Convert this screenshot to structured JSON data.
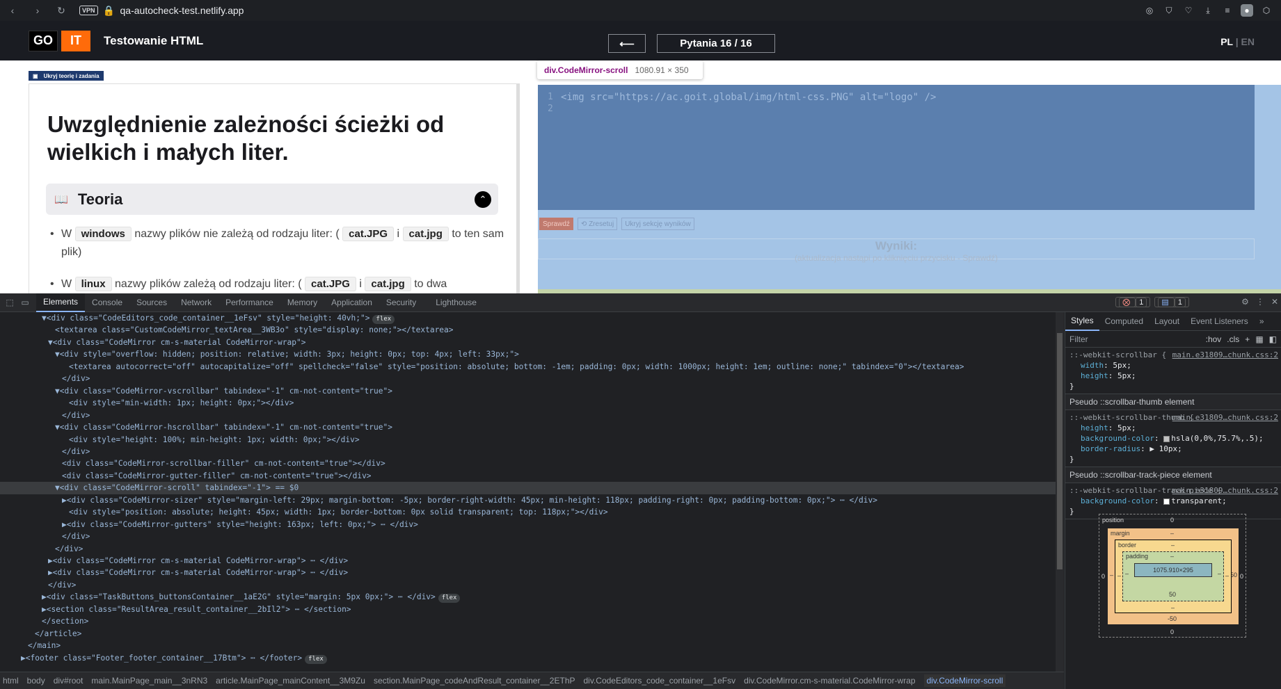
{
  "browser": {
    "url": "qa-autocheck-test.netlify.app",
    "vpn_label": "VPN"
  },
  "site": {
    "logo_go": "GO",
    "logo_it": "IT",
    "title": "Testowanie HTML",
    "back_arrow": "⟵",
    "question_counter": "Pytania 16 / 16",
    "lang_pl": "PL",
    "lang_sep": "|",
    "lang_en": "EN"
  },
  "lesson": {
    "hide_button": "Ukryj teorię i zadania",
    "heading": "Uwzględnienie zależności ścieżki od wielkich i małych liter.",
    "theory_title": "Teoria",
    "bullets": [
      {
        "pre": "W",
        "code1": "windows",
        "mid": "nazwy plików nie zależą od rodzaju liter: (",
        "code2": "cat.JPG",
        "and": "i",
        "code3": "cat.jpg",
        "post": "to ten sam plik)"
      },
      {
        "pre": "W",
        "code1": "linux",
        "mid": "nazwy plików zależą od rodzaju liter: (",
        "code2": "cat.JPG",
        "and": "i",
        "code3": "cat.jpg",
        "post": "to dwa"
      }
    ]
  },
  "editor": {
    "tooltip_name": "div.CodeMirror-scroll",
    "tooltip_size": "1080.91 × 350",
    "line_numbers": [
      "1",
      "2"
    ],
    "code_line": "<img src=\"https://ac.goit.global/img/html-css.PNG\" alt=\"logo\" />",
    "btn_check": "Sprawdź",
    "btn_reset": "Zresetuj",
    "btn_hide_results": "Ukryj sekcję wyników",
    "results_title": "Wyniki:",
    "results_sub": "(aktualizacja nastąpi po kliknięciu przycisku - Sprawdź)"
  },
  "devtools": {
    "tabs": [
      "Elements",
      "Console",
      "Sources",
      "Network",
      "Performance",
      "Memory",
      "Application",
      "Security",
      "Lighthouse"
    ],
    "error_count": "1",
    "message_count": "1",
    "dom_lines": [
      {
        "indent": 60,
        "text": "▼<div class=\"CodeEditors_code_container__1eFsv\" style=\"height: 40vh;\">",
        "pill": "flex"
      },
      {
        "indent": 79,
        "text": "<textarea class=\"CustomCodeMirror_textArea__3WB3o\" style=\"display: none;\"></textarea>"
      },
      {
        "indent": 69,
        "text": "▼<div class=\"CodeMirror cm-s-material CodeMirror-wrap\">"
      },
      {
        "indent": 79,
        "text": "▼<div style=\"overflow: hidden; position: relative; width: 3px; height: 0px; top: 4px; left: 33px;\">"
      },
      {
        "indent": 99,
        "text": "<textarea autocorrect=\"off\" autocapitalize=\"off\" spellcheck=\"false\" style=\"position: absolute; bottom: -1em; padding: 0px; width: 1000px; height: 1em; outline: none;\" tabindex=\"0\"></textarea>"
      },
      {
        "indent": 89,
        "text": "</div>"
      },
      {
        "indent": 79,
        "text": "▼<div class=\"CodeMirror-vscrollbar\" tabindex=\"-1\" cm-not-content=\"true\">"
      },
      {
        "indent": 99,
        "text": "<div style=\"min-width: 1px; height: 0px;\"></div>"
      },
      {
        "indent": 89,
        "text": "</div>"
      },
      {
        "indent": 79,
        "text": "▼<div class=\"CodeMirror-hscrollbar\" tabindex=\"-1\" cm-not-content=\"true\">"
      },
      {
        "indent": 99,
        "text": "<div style=\"height: 100%; min-height: 1px; width: 0px;\"></div>"
      },
      {
        "indent": 89,
        "text": "</div>"
      },
      {
        "indent": 89,
        "text": "<div class=\"CodeMirror-scrollbar-filler\" cm-not-content=\"true\"></div>"
      },
      {
        "indent": 89,
        "text": "<div class=\"CodeMirror-gutter-filler\" cm-not-content=\"true\"></div>"
      },
      {
        "indent": 79,
        "text": "▼<div class=\"CodeMirror-scroll\" tabindex=\"-1\"> == $0",
        "selected": true
      },
      {
        "indent": 89,
        "text": "▶<div class=\"CodeMirror-sizer\" style=\"margin-left: 29px; margin-bottom: -5px; border-right-width: 45px; min-height: 118px; padding-right: 0px; padding-bottom: 0px;\"> ⋯ </div>"
      },
      {
        "indent": 99,
        "text": "<div style=\"position: absolute; height: 45px; width: 1px; border-bottom: 0px solid transparent; top: 118px;\"></div>"
      },
      {
        "indent": 89,
        "text": "▶<div class=\"CodeMirror-gutters\" style=\"height: 163px; left: 0px;\"> ⋯ </div>"
      },
      {
        "indent": 89,
        "text": "</div>"
      },
      {
        "indent": 79,
        "text": "</div>"
      },
      {
        "indent": 69,
        "text": "▶<div class=\"CodeMirror cm-s-material CodeMirror-wrap\"> ⋯ </div>"
      },
      {
        "indent": 69,
        "text": "▶<div class=\"CodeMirror cm-s-material CodeMirror-wrap\"> ⋯ </div>"
      },
      {
        "indent": 69,
        "text": "</div>"
      },
      {
        "indent": 60,
        "text": "▶<div class=\"TaskButtons_buttonsContainer__1aE2G\" style=\"margin: 5px 0px;\"> ⋯ </div>",
        "pill": "flex"
      },
      {
        "indent": 60,
        "text": "▶<section class=\"ResultArea_result_container__2bIl2\"> ⋯ </section>"
      },
      {
        "indent": 60,
        "text": "</section>"
      },
      {
        "indent": 50,
        "text": "</article>"
      },
      {
        "indent": 40,
        "text": "</main>"
      },
      {
        "indent": 30,
        "text": "▶<footer class=\"Footer_footer_container__17Btm\"> ⋯ </footer>",
        "pill": "flex"
      }
    ],
    "breadcrumbs": [
      "html",
      "body",
      "div#root",
      "main.MainPage_main__3nRN3",
      "article.MainPage_mainContent__3M9Zu",
      "section.MainPage_codeAndResult_container__2EThP",
      "div.CodeEditors_code_container__1eFsv",
      "div.CodeMirror.cm-s-material.CodeMirror-wrap",
      "div.CodeMirror-scroll"
    ],
    "styles": {
      "tabs": [
        "Styles",
        "Computed",
        "Layout",
        "Event Listeners"
      ],
      "filter_placeholder": "Filter",
      "filter_hov": ":hov",
      "filter_cls": ".cls",
      "rule1_selector": "::-webkit-scrollbar {",
      "rule1_src": "main.e31809…chunk.css:2",
      "rule1_props": [
        [
          "width",
          "5px;"
        ],
        [
          "height",
          "5px;"
        ]
      ],
      "pseudo_thumb": "Pseudo ::scrollbar-thumb element",
      "rule2_selector": "::-webkit-scrollbar-thumb {",
      "rule2_src": "main.e31809…chunk.css:2",
      "rule2_props": [
        [
          "height",
          "5px;"
        ],
        [
          "background-color",
          "hsla(0,0%,75.7%,.5);"
        ],
        [
          "border-radius",
          "▶ 10px;"
        ]
      ],
      "pseudo_track": "Pseudo ::scrollbar-track-piece element",
      "rule3_selector": "::-webkit-scrollbar-track-piece {",
      "rule3_src": "main.e31809…chunk.css:2",
      "rule3_props": [
        [
          "background-color",
          "transparent;"
        ]
      ],
      "close_brace": "}"
    },
    "boxmodel": {
      "position_label": "position",
      "position_val": "0",
      "margin_label": "margin",
      "margin_val": "–",
      "border_label": "border",
      "border_val": "–",
      "padding_label": "padding",
      "padding_val": "–",
      "content": "1075.910×295",
      "padding_bottom": "50",
      "border_bottom": "–",
      "margin_bottom": "-50",
      "right_margin": "-50",
      "left_pos": "0",
      "right_pos": "0",
      "bottom_pos": "0",
      "left_margin": "–",
      "left_border": "–",
      "left_padding": "–",
      "right_border": "–",
      "right_padding": "–"
    }
  },
  "colors": {
    "accent_orange": "#ff6b0a",
    "editor_bg": "#5b7fae",
    "devtools_bg": "#202124"
  }
}
